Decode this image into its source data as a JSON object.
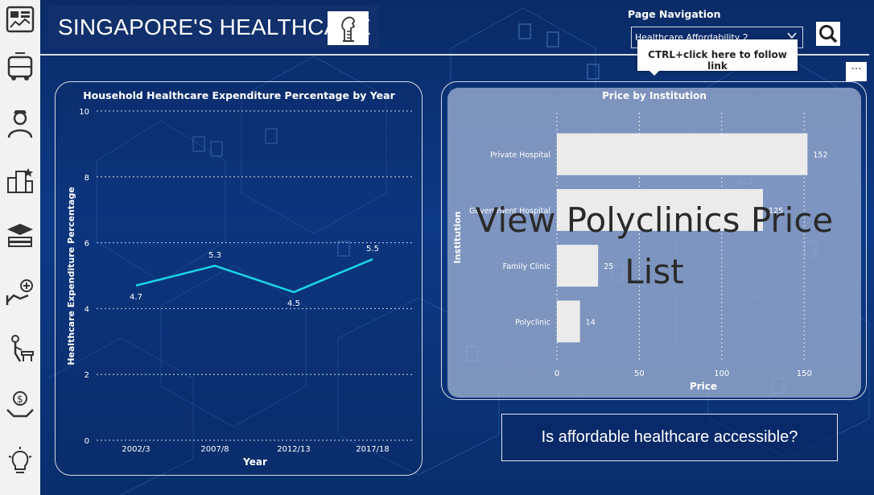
{
  "header": {
    "title": "SINGAPORE'S HEALTHCARE",
    "logo_icon": "merlion-icon"
  },
  "navigation": {
    "label": "Page Navigation",
    "selected": "Healthcare Affordability 2",
    "tooltip": "CTRL+click here to follow link",
    "more_label": "···"
  },
  "sidebar": {
    "items": [
      {
        "icon": "dashboard-icon"
      },
      {
        "icon": "transport-icon"
      },
      {
        "icon": "worker-icon"
      },
      {
        "icon": "city-icon"
      },
      {
        "icon": "education-icon"
      },
      {
        "icon": "health-care-icon"
      },
      {
        "icon": "elderly-icon"
      },
      {
        "icon": "money-hand-icon"
      },
      {
        "icon": "lightbulb-icon"
      }
    ]
  },
  "line_chart": {
    "chart_data": {
      "type": "line",
      "title": "Household Healthcare Expenditure Percentage by Year",
      "xlabel": "Year",
      "ylabel": "Healthcare Expenditure Percentage",
      "categories": [
        "2002/3",
        "2007/8",
        "2012/13",
        "2017/18"
      ],
      "values": [
        4.7,
        5.3,
        4.5,
        5.5
      ],
      "ylim": [
        0,
        10
      ],
      "yticks": [
        "0",
        "2",
        "4",
        "6",
        "8",
        "10"
      ],
      "grid": true,
      "color": "#19d6e8"
    }
  },
  "bar_chart": {
    "chart_data": {
      "type": "bar",
      "orientation": "horizontal",
      "title": "Price by Institution",
      "xlabel": "Price",
      "ylabel": "Institution",
      "categories": [
        "Private Hospital",
        "Government Hospital",
        "Family Clinic",
        "Polyclinic"
      ],
      "values": [
        152,
        125,
        25,
        14
      ],
      "xlim": [
        0,
        165
      ],
      "xticks": [
        "0",
        "50",
        "100",
        "150"
      ],
      "grid": true,
      "color": "#ebebeb"
    },
    "overlay_text": "View Polyclinics Price List"
  },
  "question_button": "Is affordable healthcare accessible?"
}
